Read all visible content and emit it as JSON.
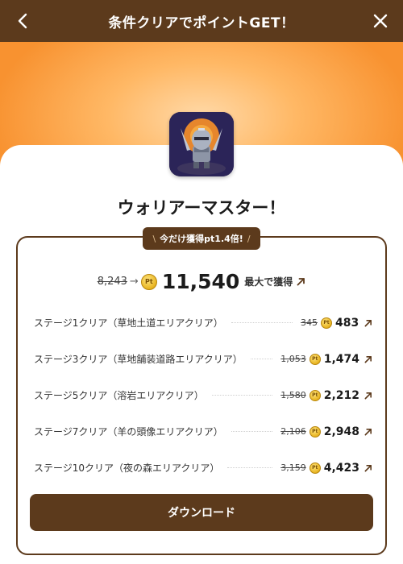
{
  "header": {
    "title": "条件クリアでポイントGET！"
  },
  "app": {
    "name": "ウォリアーマスター！"
  },
  "badge": {
    "text": "今だけ獲得pt1.4倍!"
  },
  "total": {
    "old": "8,243",
    "new": "11,540",
    "suffix": "最大で獲得",
    "coin_label": "Pt"
  },
  "conditions": [
    {
      "label": "ステージ1クリア（草地土道エリアクリア）",
      "old": "345",
      "new": "483"
    },
    {
      "label": "ステージ3クリア（草地舗装道路エリアクリア）",
      "old": "1,053",
      "new": "1,474"
    },
    {
      "label": "ステージ5クリア（溶岩エリアクリア）",
      "old": "1,580",
      "new": "2,212"
    },
    {
      "label": "ステージ7クリア（羊の頭像エリアクリア）",
      "old": "2,106",
      "new": "2,948"
    },
    {
      "label": "ステージ10クリア（夜の森エリアクリア）",
      "old": "3,159",
      "new": "4,423"
    }
  ],
  "download": {
    "label": "ダウンロード"
  },
  "colors": {
    "brand_brown": "#5c3a1c",
    "hero_orange": "#f89230",
    "coin_gold": "#e8b420"
  }
}
